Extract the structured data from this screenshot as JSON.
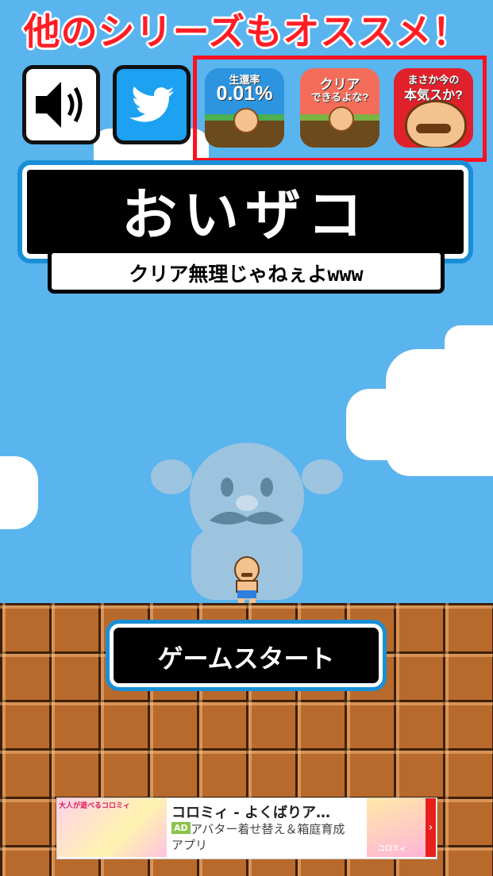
{
  "banner": {
    "text": "他のシリーズもオススメ！"
  },
  "controls": {
    "sound": "sound-icon",
    "twitter": "twitter-bird-icon"
  },
  "series_apps": [
    {
      "line1": "生還率",
      "line2": "0.01%"
    },
    {
      "line1": "クリア",
      "line2": "できるよな?"
    },
    {
      "line1": "まさか今の",
      "line2": "本気スか?"
    }
  ],
  "title": {
    "main": "おいザコ",
    "subtitle": "クリア無理じゃねぇよwww"
  },
  "start": {
    "label": "ゲームスタート"
  },
  "ad": {
    "title": "コロミィ - よくばりア…",
    "badge": "AD",
    "desc_line1": "アバター着せ替え＆箱庭育成",
    "desc_line2": "アプリ",
    "left_image_text": "大人が遊べるコロミィ",
    "right_image_text": "コロミィ"
  },
  "colors": {
    "sky": "#5ab4ee",
    "banner_red": "#ff1d25",
    "brick": "#b86a2c",
    "accent_blue": "#1a8fd8",
    "ad_arrow": "#e8201d"
  }
}
